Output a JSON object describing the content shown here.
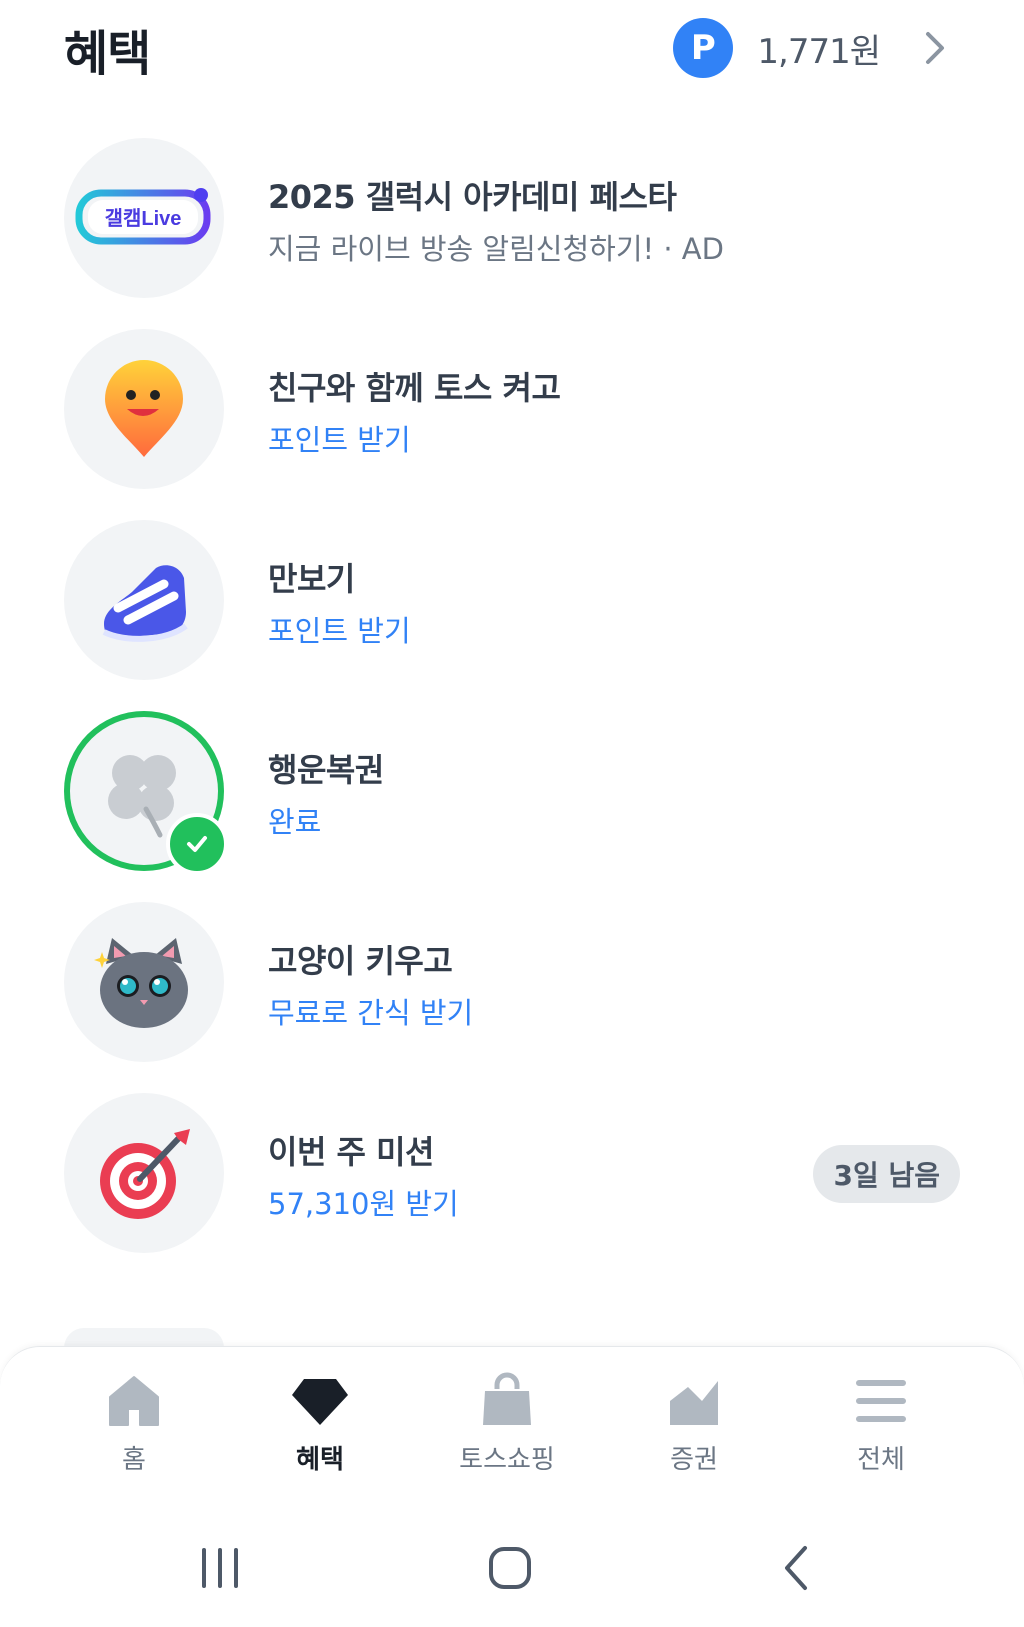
{
  "header": {
    "title": "혜택",
    "points_badge": "P",
    "points_amount": "1,771원",
    "chevron_icon": "chevron-right-icon"
  },
  "rows": [
    {
      "title": "2025 갤럭시 아카데미 페스타",
      "sub": "지금 라이브 방송 알림신청하기! · AD",
      "logo_text": "갤캠Live",
      "icon": "galcam-live-logo"
    },
    {
      "title": "친구와 함께 토스 켜고",
      "sub": "포인트 받기",
      "icon": "smiley-pin-icon"
    },
    {
      "title": "만보기",
      "sub": "포인트 받기",
      "icon": "sneaker-icon"
    },
    {
      "title": "행운복권",
      "sub": "완료",
      "icon": "clover-icon",
      "status": "done"
    },
    {
      "title": "고양이 키우고",
      "sub": "무료로 간식 받기",
      "icon": "cat-icon"
    },
    {
      "title": "이번 주 미션",
      "sub": "57,310원 받기",
      "icon": "target-dart-icon",
      "badge": "3일 남음"
    }
  ],
  "tabbar": {
    "tabs": [
      {
        "label": "홈",
        "icon": "home-icon",
        "active": false
      },
      {
        "label": "혜택",
        "icon": "gem-icon",
        "active": true
      },
      {
        "label": "토스쇼핑",
        "icon": "shopping-bag-icon",
        "active": false
      },
      {
        "label": "증권",
        "icon": "stock-chart-icon",
        "active": false
      },
      {
        "label": "전체",
        "icon": "menu-icon",
        "active": false
      }
    ]
  },
  "system_nav": [
    "recents-icon",
    "home-button-icon",
    "back-icon"
  ],
  "colors": {
    "accent": "#3182f6",
    "success": "#21c05c",
    "text": "#333d4b",
    "muted": "#6b7684"
  }
}
